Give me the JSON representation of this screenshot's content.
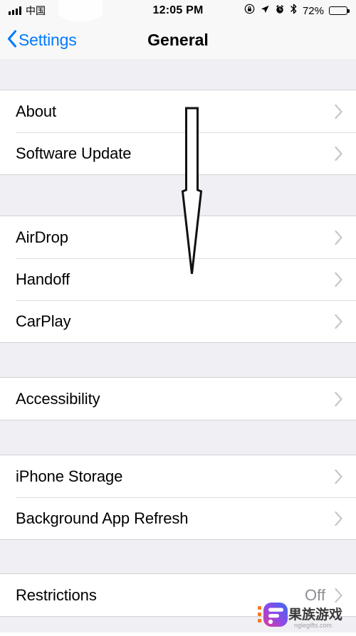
{
  "status_bar": {
    "carrier": "中国",
    "signal_icon": "signal-bars-icon",
    "wifi_icon": "wifi-icon",
    "time": "12:05 PM",
    "rotation_lock_icon": "rotation-lock-icon",
    "location_icon": "location-arrow-icon",
    "alarm_icon": "alarm-clock-icon",
    "bluetooth_icon": "bluetooth-icon",
    "battery_percent": "72%",
    "battery_level": 72,
    "battery_icon": "battery-icon"
  },
  "nav_bar": {
    "back_label": "Settings",
    "back_icon": "chevron-left-icon",
    "title": "General"
  },
  "groups": [
    {
      "id": "group-info",
      "rows": [
        {
          "label": "About",
          "value": "",
          "accessory": "chevron-right-icon"
        },
        {
          "label": "Software Update",
          "value": "",
          "accessory": "chevron-right-icon"
        }
      ]
    },
    {
      "id": "group-continuity",
      "rows": [
        {
          "label": "AirDrop",
          "value": "",
          "accessory": "chevron-right-icon"
        },
        {
          "label": "Handoff",
          "value": "",
          "accessory": "chevron-right-icon"
        },
        {
          "label": "CarPlay",
          "value": "",
          "accessory": "chevron-right-icon"
        }
      ]
    },
    {
      "id": "group-accessibility",
      "rows": [
        {
          "label": "Accessibility",
          "value": "",
          "accessory": "chevron-right-icon"
        }
      ]
    },
    {
      "id": "group-storage",
      "rows": [
        {
          "label": "iPhone Storage",
          "value": "",
          "accessory": "chevron-right-icon"
        },
        {
          "label": "Background App Refresh",
          "value": "",
          "accessory": "chevron-right-icon"
        }
      ]
    },
    {
      "id": "group-restrictions",
      "rows": [
        {
          "label": "Restrictions",
          "value": "Off",
          "accessory": "chevron-right-icon"
        }
      ]
    }
  ],
  "annotation": {
    "arrow_icon": "down-arrow-annotation",
    "stroke_color": "#000000",
    "fill_color": "#FFFFFF"
  },
  "watermark": {
    "text": "果族游戏",
    "subtext": "nglegifts.com",
    "logo_icon": "app-logo-icon",
    "gradient_start": "#E0399B",
    "gradient_end": "#3C6BF0",
    "accent_color": "#F57C20"
  },
  "colors": {
    "accent": "#007AFF",
    "group_bg": "#FFFFFF",
    "page_bg": "#EFEFF4",
    "separator": "#DCDCDE",
    "secondary_text": "#8E8E93"
  }
}
